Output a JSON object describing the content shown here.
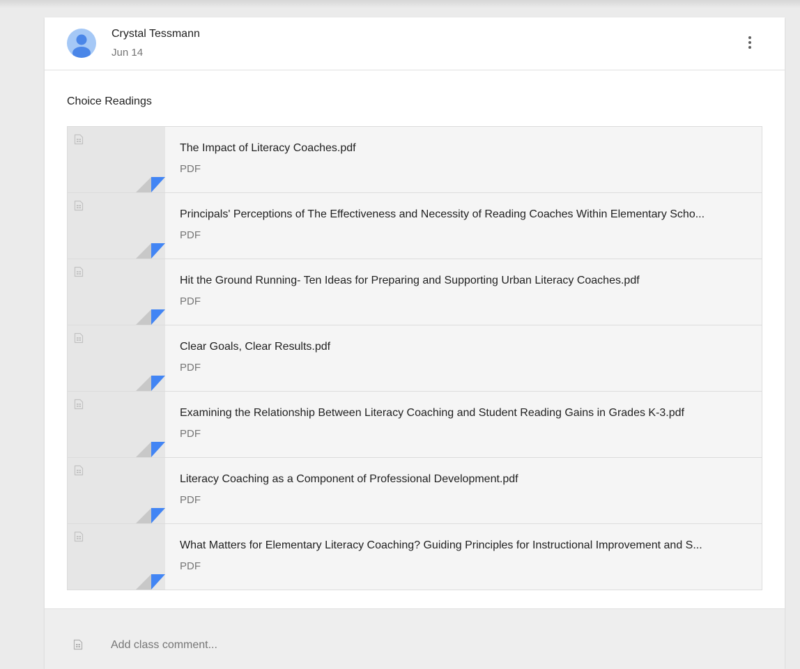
{
  "post": {
    "author": "Crystal Tessmann",
    "date": "Jun 14",
    "title": "Choice Readings"
  },
  "attachments": [
    {
      "title": "The Impact of Literacy Coaches.pdf",
      "type": "PDF"
    },
    {
      "title": "Principals' Perceptions of The Effectiveness and Necessity of Reading Coaches Within Elementary Scho...",
      "type": "PDF"
    },
    {
      "title": "Hit the Ground Running- Ten Ideas for Preparing and Supporting Urban Literacy Coaches.pdf",
      "type": "PDF"
    },
    {
      "title": "Clear Goals, Clear Results.pdf",
      "type": "PDF"
    },
    {
      "title": "Examining the Relationship Between Literacy Coaching and Student Reading Gains in Grades K-3.pdf",
      "type": "PDF"
    },
    {
      "title": "Literacy Coaching as a Component of Professional Development.pdf",
      "type": "PDF"
    },
    {
      "title": "What Matters for Elementary Literacy Coaching? Guiding Principles for Instructional Improvement and S...",
      "type": "PDF"
    }
  ],
  "comment": {
    "placeholder": "Add class comment..."
  },
  "icons": {
    "avatar": "person-avatar-icon",
    "menu": "more-vert-icon",
    "file": "file-icon",
    "comment": "comment-icon"
  },
  "colors": {
    "accent": "#4285f4",
    "avatar_bg": "#a5c8f6",
    "avatar_fg": "#4a86e8"
  }
}
